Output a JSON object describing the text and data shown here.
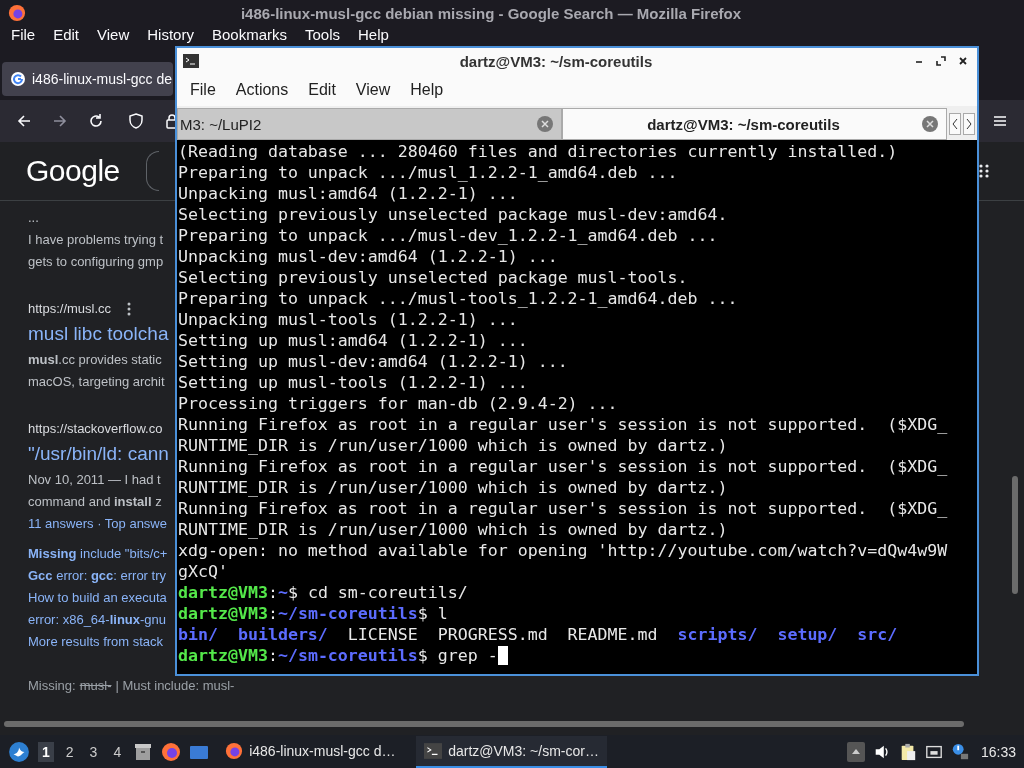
{
  "browser": {
    "title": "i486-linux-musl-gcc debian missing - Google Search — Mozilla Firefox",
    "menu": [
      "File",
      "Edit",
      "View",
      "History",
      "Bookmarks",
      "Tools",
      "Help"
    ],
    "tab": {
      "label": "i486-linux-musl-gcc de",
      "selected": true
    },
    "logo": "Google",
    "results": [
      {
        "kind": "snippet",
        "text": "..."
      },
      {
        "kind": "snippet",
        "text": "I have problems trying t"
      },
      {
        "kind": "snippet",
        "text": "gets to configuring gmp"
      },
      {
        "kind": "url",
        "text": "https://musl.cc"
      },
      {
        "kind": "title",
        "text": "musl libc toolcha"
      },
      {
        "kind": "snippet",
        "text": "**musl**.cc provides static"
      },
      {
        "kind": "snippet",
        "text": "macOS, targeting archit"
      },
      {
        "kind": "url",
        "text": "https://stackoverflow.co"
      },
      {
        "kind": "title",
        "text": "\"/usr/bin/ld: cann"
      },
      {
        "kind": "snippet",
        "text": "Nov 10, 2011 — I had t"
      },
      {
        "kind": "snippet",
        "text": "command and **install** z"
      },
      {
        "kind": "meta",
        "text": "11 answers · Top answe"
      },
      {
        "kind": "sublink",
        "text": "**Missing** include \"bits/c+"
      },
      {
        "kind": "sublink",
        "text": "**Gcc** error: **gcc**: error try"
      },
      {
        "kind": "sublink",
        "text": "How to build an executa"
      },
      {
        "kind": "sublink",
        "text": "error: x86_64-**linux**-gnu"
      },
      {
        "kind": "sublink",
        "text": "More results from stack"
      },
      {
        "kind": "missing",
        "label": "Missing:",
        "struck": "musl-",
        "rest": "| Must include: musl-"
      }
    ]
  },
  "terminal": {
    "title": "dartz@VM3: ~/sm-coreutils",
    "menu": [
      "File",
      "Actions",
      "Edit",
      "View",
      "Help"
    ],
    "tabs": [
      {
        "label": "M3: ~/LuPI2",
        "selected": false
      },
      {
        "label": "dartz@VM3: ~/sm-coreutils",
        "selected": true
      }
    ],
    "cursor": true,
    "lines": [
      {
        "kind": "output",
        "text": "(Reading database ... 280460 files and directories currently installed.)"
      },
      {
        "kind": "output",
        "text": "Preparing to unpack .../musl_1.2.2-1_amd64.deb ..."
      },
      {
        "kind": "output",
        "text": "Unpacking musl:amd64 (1.2.2-1) ..."
      },
      {
        "kind": "output",
        "text": "Selecting previously unselected package musl-dev:amd64."
      },
      {
        "kind": "output",
        "text": "Preparing to unpack .../musl-dev_1.2.2-1_amd64.deb ..."
      },
      {
        "kind": "output",
        "text": "Unpacking musl-dev:amd64 (1.2.2-1) ..."
      },
      {
        "kind": "output",
        "text": "Selecting previously unselected package musl-tools."
      },
      {
        "kind": "output",
        "text": "Preparing to unpack .../musl-tools_1.2.2-1_amd64.deb ..."
      },
      {
        "kind": "output",
        "text": "Unpacking musl-tools (1.2.2-1) ..."
      },
      {
        "kind": "output",
        "text": "Setting up musl:amd64 (1.2.2-1) ..."
      },
      {
        "kind": "output",
        "text": "Setting up musl-dev:amd64 (1.2.2-1) ..."
      },
      {
        "kind": "output",
        "text": "Setting up musl-tools (1.2.2-1) ..."
      },
      {
        "kind": "output",
        "text": "Processing triggers for man-db (2.9.4-2) ..."
      },
      {
        "kind": "output",
        "text": "Running Firefox as root in a regular user's session is not supported.  ($XDG_"
      },
      {
        "kind": "output",
        "text": "RUNTIME_DIR is /run/user/1000 which is owned by dartz.)"
      },
      {
        "kind": "output",
        "text": "Running Firefox as root in a regular user's session is not supported.  ($XDG_"
      },
      {
        "kind": "output",
        "text": "RUNTIME_DIR is /run/user/1000 which is owned by dartz.)"
      },
      {
        "kind": "output",
        "text": "Running Firefox as root in a regular user's session is not supported.  ($XDG_"
      },
      {
        "kind": "output",
        "text": "RUNTIME_DIR is /run/user/1000 which is owned by dartz.)"
      },
      {
        "kind": "output",
        "text": "xdg-open: no method available for opening 'http://youtube.com/watch?v=dQw4w9W"
      },
      {
        "kind": "output",
        "text": "gXcQ'"
      },
      {
        "kind": "prompt",
        "user": "dartz@VM3",
        "sep": ":",
        "path": "~",
        "command": "$ cd sm-coreutils/"
      },
      {
        "kind": "prompt",
        "user": "dartz@VM3",
        "sep": ":",
        "path": "~/sm-coreutils",
        "command": "$ l"
      },
      {
        "kind": "listing",
        "entries": [
          {
            "text": "bin/",
            "kind": "dir"
          },
          {
            "text": "builders/",
            "kind": "dir"
          },
          {
            "text": "LICENSE",
            "kind": "file"
          },
          {
            "text": "PROGRESS.md",
            "kind": "file"
          },
          {
            "text": "README.md",
            "kind": "file"
          },
          {
            "text": "scripts/",
            "kind": "dir"
          },
          {
            "text": "setup/",
            "kind": "dir"
          },
          {
            "text": "src/",
            "kind": "dir"
          }
        ]
      },
      {
        "kind": "prompt",
        "user": "dartz@VM3",
        "sep": ":",
        "path": "~/sm-coreutils",
        "command": "$ grep -"
      }
    ]
  },
  "taskbar": {
    "workspaces": [
      {
        "label": "1",
        "selected": true
      },
      {
        "label": "2",
        "selected": false
      },
      {
        "label": "3",
        "selected": false
      },
      {
        "label": "4",
        "selected": false
      }
    ],
    "tasks": [
      {
        "label": "i486-linux-musl-gcc d…",
        "kind": "firefox",
        "selected": false
      },
      {
        "label": "dartz@VM3: ~/sm-cor…",
        "kind": "terminal",
        "selected": true
      }
    ],
    "clock": "16:33"
  }
}
